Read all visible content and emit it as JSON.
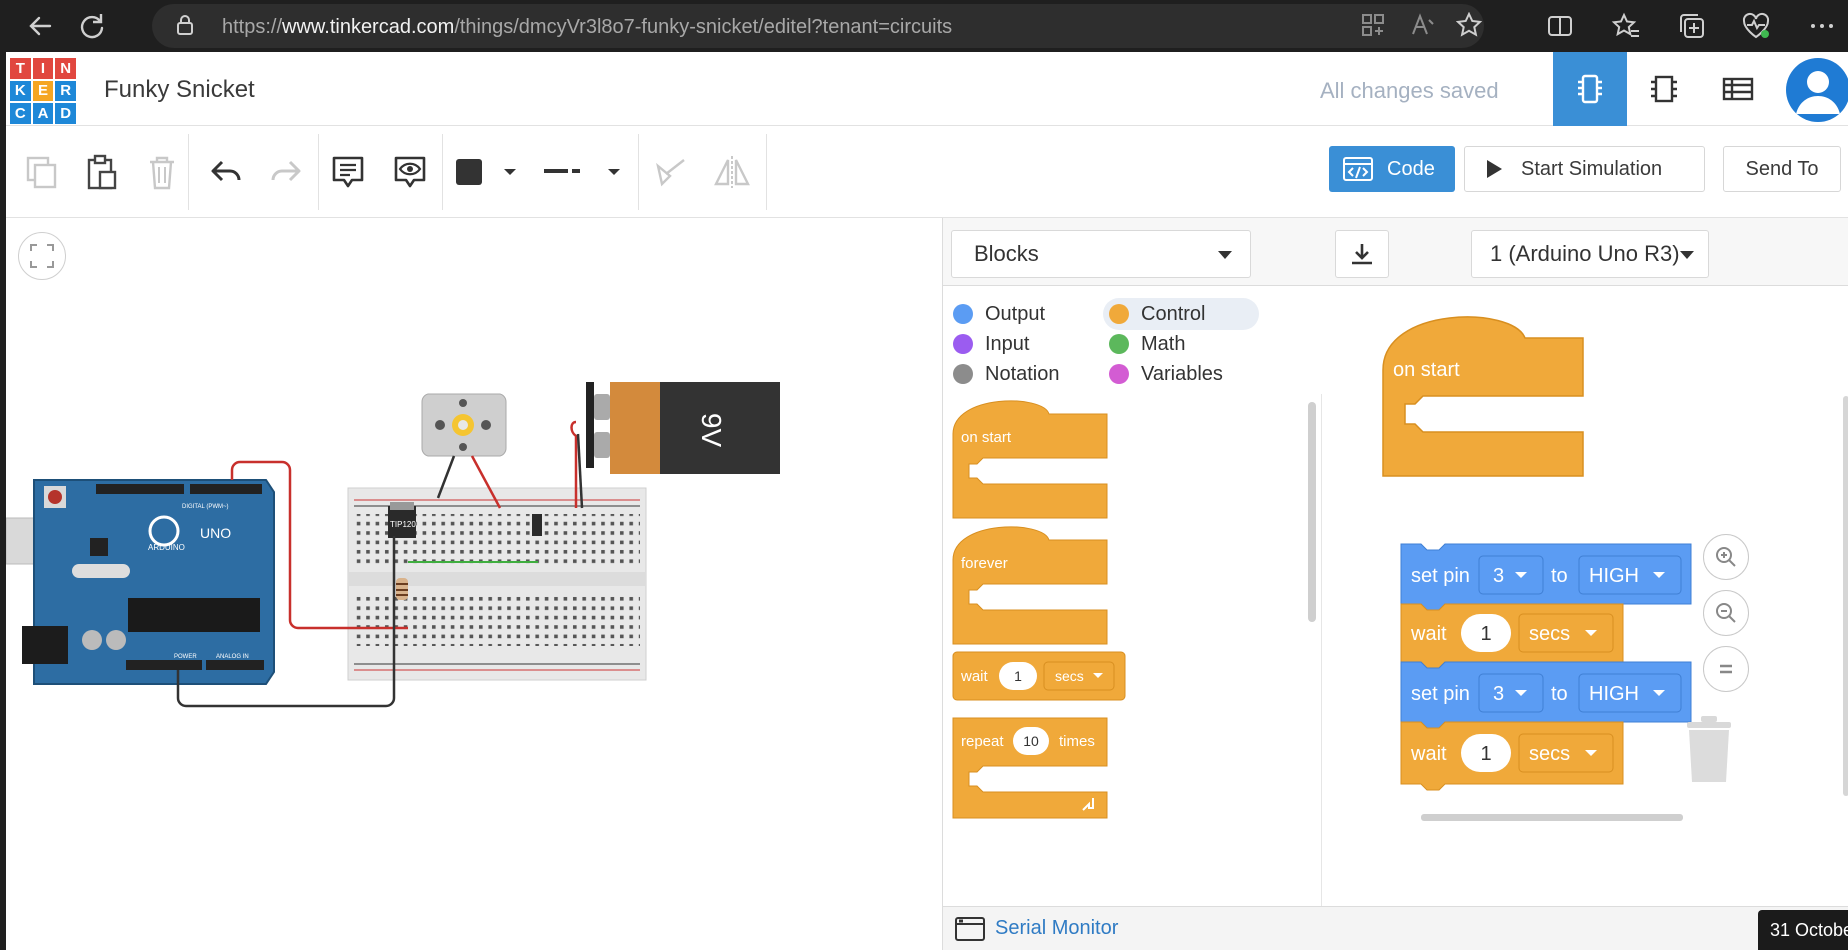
{
  "browser": {
    "url_prefix": "https://",
    "url_host": "www.tinkercad.com",
    "url_path": "/things/dmcyVr3l8o7-funky-snicket/editel?tenant=circuits"
  },
  "header": {
    "logo_letters": [
      "T",
      "I",
      "N",
      "K",
      "E",
      "R",
      "C",
      "A",
      "D"
    ],
    "logo_colors": [
      "#e1473f",
      "#e1473f",
      "#e1473f",
      "#1e88d8",
      "#f5a623",
      "#1e88d8",
      "#1e88d8",
      "#1e88d8",
      "#1e88d8"
    ],
    "project_title": "Funky Snicket",
    "save_status": "All changes saved"
  },
  "toolbar": {
    "code_label": "Code",
    "start_simulation_label": "Start Simulation",
    "send_to_label": "Send To"
  },
  "code_panel": {
    "mode_label": "Blocks",
    "device_label": "1 (Arduino Uno R3)",
    "categories": [
      {
        "label": "Output",
        "color": "#5b9cf3"
      },
      {
        "label": "Control",
        "color": "#f0a93a"
      },
      {
        "label": "Input",
        "color": "#9b5cf0"
      },
      {
        "label": "Math",
        "color": "#5cb85c"
      },
      {
        "label": "Notation",
        "color": "#8c8c8c"
      },
      {
        "label": "Variables",
        "color": "#d35cd3"
      }
    ],
    "palette": {
      "on_start": "on start",
      "forever": "forever",
      "wait": "wait",
      "wait_value": "1",
      "secs": "secs",
      "repeat": "repeat",
      "repeat_value": "10",
      "times": "times"
    },
    "workspace": {
      "on_start": "on start",
      "set_pin_1": {
        "label": "set pin",
        "pin": "3",
        "to": "to",
        "state": "HIGH"
      },
      "wait_1": {
        "label": "wait",
        "value": "1",
        "unit": "secs"
      },
      "set_pin_2": {
        "label": "set pin",
        "pin": "3",
        "to": "to",
        "state": "HIGH"
      },
      "wait_2": {
        "label": "wait",
        "value": "1",
        "unit": "secs"
      }
    },
    "serial_monitor_label": "Serial Monitor"
  },
  "circuit": {
    "battery_label": "9V",
    "transistor_label": "TIP120",
    "arduino_label": "ARDUINO",
    "arduino_model": "UNO",
    "digital_label": "DIGITAL (PWM~)",
    "power_label": "POWER",
    "analog_label": "ANALOG IN"
  },
  "taskbar": {
    "date_fragment": "31 Octobe"
  },
  "colors": {
    "control_block": "#f0a93a",
    "output_block": "#5b9cf3",
    "accent": "#3a8fd6"
  }
}
